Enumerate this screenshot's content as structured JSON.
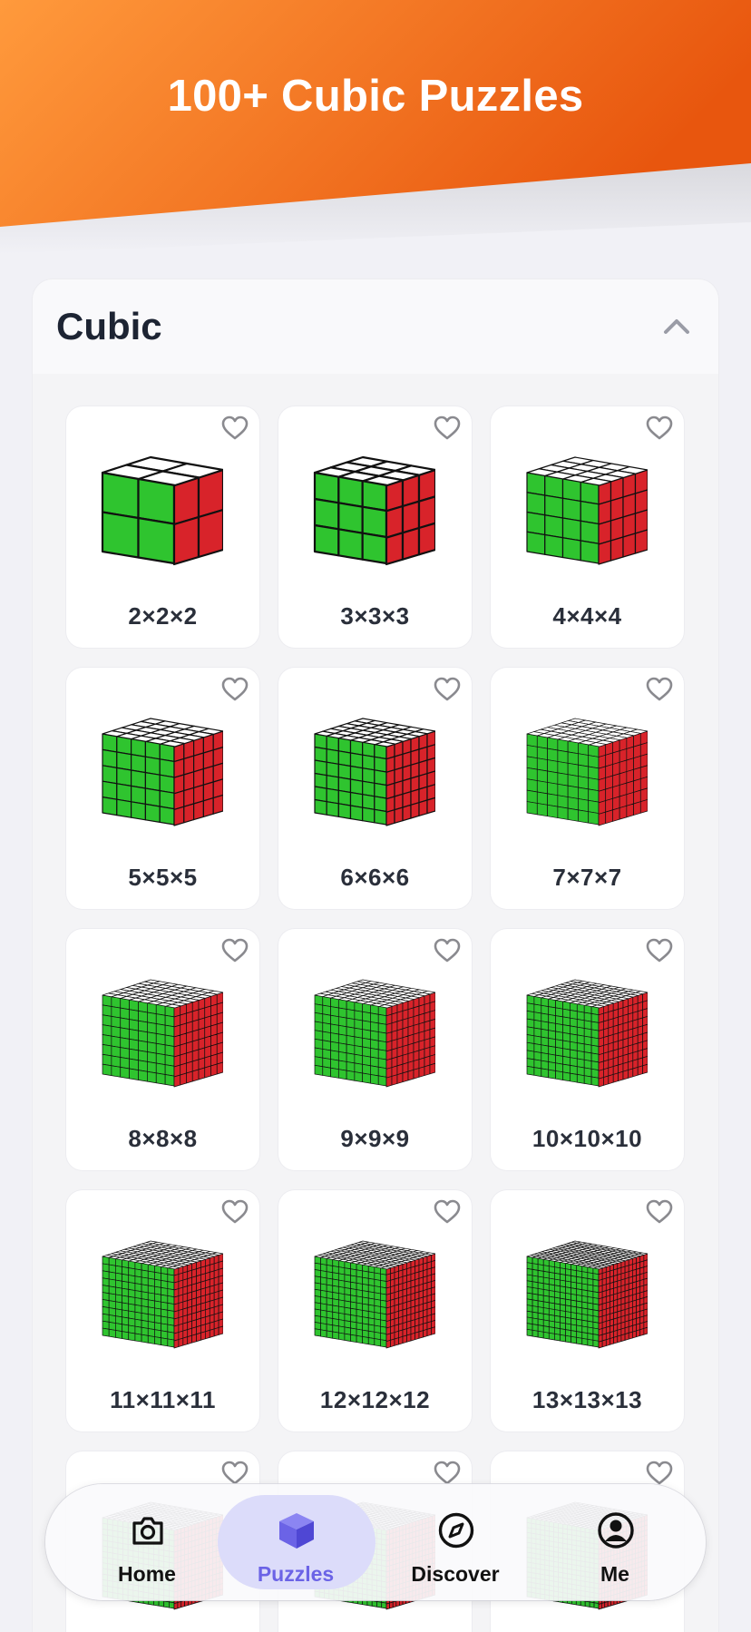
{
  "banner": {
    "title": "100+ Cubic Puzzles"
  },
  "section": {
    "title": "Cubic",
    "collapse_icon": "chevron-up-icon"
  },
  "puzzles": [
    {
      "label": "2×2×2",
      "n": 2,
      "favorite": false
    },
    {
      "label": "3×3×3",
      "n": 3,
      "favorite": false
    },
    {
      "label": "4×4×4",
      "n": 4,
      "favorite": false
    },
    {
      "label": "5×5×5",
      "n": 5,
      "favorite": false
    },
    {
      "label": "6×6×6",
      "n": 6,
      "favorite": false
    },
    {
      "label": "7×7×7",
      "n": 7,
      "favorite": false
    },
    {
      "label": "8×8×8",
      "n": 8,
      "favorite": false
    },
    {
      "label": "9×9×9",
      "n": 9,
      "favorite": false
    },
    {
      "label": "10×10×10",
      "n": 10,
      "favorite": false
    },
    {
      "label": "11×11×11",
      "n": 11,
      "favorite": false
    },
    {
      "label": "12×12×12",
      "n": 12,
      "favorite": false
    },
    {
      "label": "13×13×13",
      "n": 13,
      "favorite": false
    },
    {
      "label": "",
      "n": 14,
      "favorite": false
    },
    {
      "label": "",
      "n": 15,
      "favorite": false
    },
    {
      "label": "",
      "n": 16,
      "favorite": false
    }
  ],
  "nav": {
    "items": [
      {
        "label": "Home",
        "icon": "camera-icon",
        "active": false
      },
      {
        "label": "Puzzles",
        "icon": "cube-icon",
        "active": true
      },
      {
        "label": "Discover",
        "icon": "compass-icon",
        "active": false
      },
      {
        "label": "Me",
        "icon": "user-icon",
        "active": false
      }
    ]
  },
  "colors": {
    "banner_start": "#ff9a3c",
    "banner_end": "#e8560e",
    "cube_front": "#2fc42f",
    "cube_right": "#d8232a",
    "cube_top": "#ffffff",
    "active_nav": "#6b63e6"
  }
}
